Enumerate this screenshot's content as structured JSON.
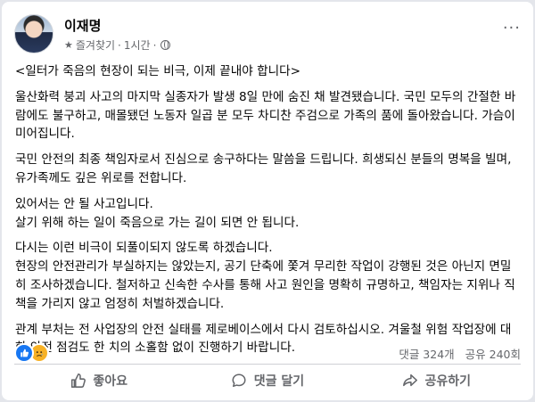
{
  "post": {
    "author": "이재명",
    "favorite_label": "즐겨찾기",
    "separator": "·",
    "time": "1시간",
    "more_label": "···",
    "paragraphs": [
      "<일터가 죽음의 현장이 되는 비극, 이제 끝내야 합니다>",
      "울산화력 붕괴 사고의 마지막 실종자가 발생 8일 만에 숨진 채 발견됐습니다. 국민 모두의 간절한 바람에도 불구하고, 매몰됐던 노동자 일곱 분 모두 차디찬 주검으로 가족의 품에 돌아왔습니다. 가슴이 미어집니다.",
      "국민 안전의 최종 책임자로서 진심으로 송구하다는 말씀을 드립니다. 희생되신 분들의 명복을 빌며, 유가족께도 깊은 위로를 전합니다.",
      "있어서는 안 될 사고입니다.\n살기 위해 하는 일이 죽음으로 가는 길이 되면 안 됩니다.",
      "다시는 이런 비극이 되풀이되지 않도록 하겠습니다.\n현장의 안전관리가 부실하지는 않았는지, 공기 단축에 쫓겨 무리한 작업이 강행된 것은 아닌지 면밀히 조사하겠습니다. 철저하고 신속한 수사를 통해 사고 원인을 명확히 규명하고, 책임자는 지위나 직책을 가리지 않고 엄정히 처벌하겠습니다.",
      "관계 부처는 전 사업장의 안전 실태를 제로베이스에서 다시 검토하십시오. 겨울철 위험 작업장에 대한 안전 점검도 한 치의 소홀함 없이 진행하기 바랍니다."
    ]
  },
  "reactions": {
    "icons": [
      "like-icon",
      "sad-icon"
    ],
    "comments_label": "댓글 324개",
    "shares_label": "공유 240회"
  },
  "actions": {
    "like_label": "좋아요",
    "comment_label": "댓글 달기",
    "share_label": "공유하기"
  },
  "colors": {
    "accent": "#1877f2",
    "secondary_text": "#65676b",
    "background": "#e4e6eb",
    "sad_reaction": "#f7b125"
  }
}
